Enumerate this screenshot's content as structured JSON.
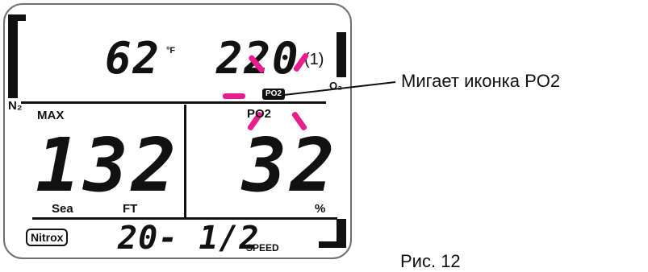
{
  "display": {
    "temperature_value": "62",
    "temperature_unit": "°F",
    "po2_value": "220",
    "po2_paren": "(1)",
    "o2_label": "O₂",
    "n2_label": "N₂",
    "max_label": "MAX",
    "depth_value": "132",
    "po2_bottom_label": "PO2",
    "po2_badge": "PO2",
    "percent_value": "32",
    "percent_unit": "%",
    "sea_label": "Sea",
    "ft_label": "FT",
    "nitrox_label": "Nitrox",
    "speed_value": "20- 1/2",
    "speed_label": "SPEED"
  },
  "callout": {
    "text": "Мигает иконка PO2"
  },
  "caption": {
    "text": "Рис. 12"
  },
  "colors": {
    "blink_marker": "#e91e8c",
    "lcd_ink": "#111111"
  }
}
